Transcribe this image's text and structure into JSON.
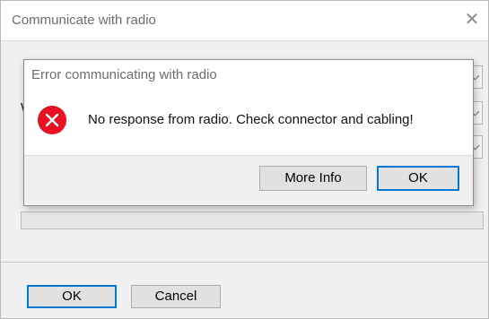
{
  "window": {
    "title": "Communicate with radio",
    "close_icon": "close-icon",
    "bg_label_partial": "W"
  },
  "buttons": {
    "ok_label": "OK",
    "cancel_label": "Cancel"
  },
  "error_dialog": {
    "title": "Error communicating with radio",
    "icon": "error-icon",
    "message": "No response from radio. Check connector and cabling!",
    "more_info_label": "More Info",
    "ok_label": "OK"
  },
  "colors": {
    "error_red": "#e81123",
    "accent_blue": "#0078d7"
  }
}
